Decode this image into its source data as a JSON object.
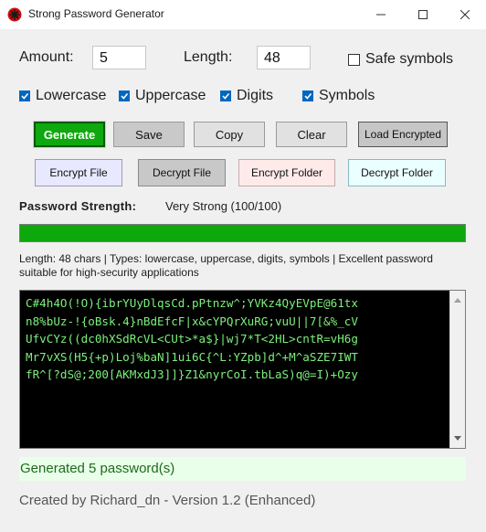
{
  "window": {
    "title": "Strong Password Generator",
    "icon": "red-cross-icon",
    "controls": [
      "minimize-icon",
      "maximize-icon",
      "close-icon"
    ]
  },
  "options": {
    "amount_label": "Amount:",
    "amount_value": "5",
    "length_label": "Length:",
    "length_value": "48",
    "safe_symbols": {
      "label": "Safe symbols",
      "checked": false
    },
    "lowercase": {
      "label": "Lowercase",
      "checked": true
    },
    "uppercase": {
      "label": "Uppercase",
      "checked": true
    },
    "digits": {
      "label": "Digits",
      "checked": true
    },
    "symbols": {
      "label": "Symbols",
      "checked": true
    }
  },
  "buttons": {
    "generate": "Generate",
    "save": "Save",
    "copy": "Copy",
    "clear": "Clear",
    "load_encrypted": "Load Encrypted",
    "encrypt_file": "Encrypt File",
    "decrypt_file": "Decrypt File",
    "encrypt_folder": "Encrypt Folder",
    "decrypt_folder": "Decrypt Folder"
  },
  "strength": {
    "label": "Password Strength:",
    "value": "Very Strong (100/100)",
    "progress": 1.0,
    "color": "#0ca80c"
  },
  "info_text": "Length: 48 chars | Types: lowercase, uppercase, digits, symbols | Excellent password suitable for high-security applications",
  "passwords": [
    "C#4h4O(!O){ibrYUyDlqsCd.pPtnzw^;YVKz4QyEVpE@61tx",
    "n8%bUz-!{oBsk.4}nBdEfcF|x&cYPQrXuRG;vuU||7[&%_cV",
    "UfvCYz((dc0hXSdRcVL<CUt>*a$}|wj7*T<2HL>cntR=vH6g",
    "Mr7vXS(H5{+p)Loj%baN]1ui6C{^L:YZpb]d^+M^aSZE7IWT",
    "fR^[?dS@;200[AKMxdJ3]]}Z1&nyrCoI.tbLaS)q@=I)+Ozy"
  ],
  "status": "Generated 5 password(s)",
  "footer": "Created by Richard_dn - Version 1.2 (Enhanced)"
}
